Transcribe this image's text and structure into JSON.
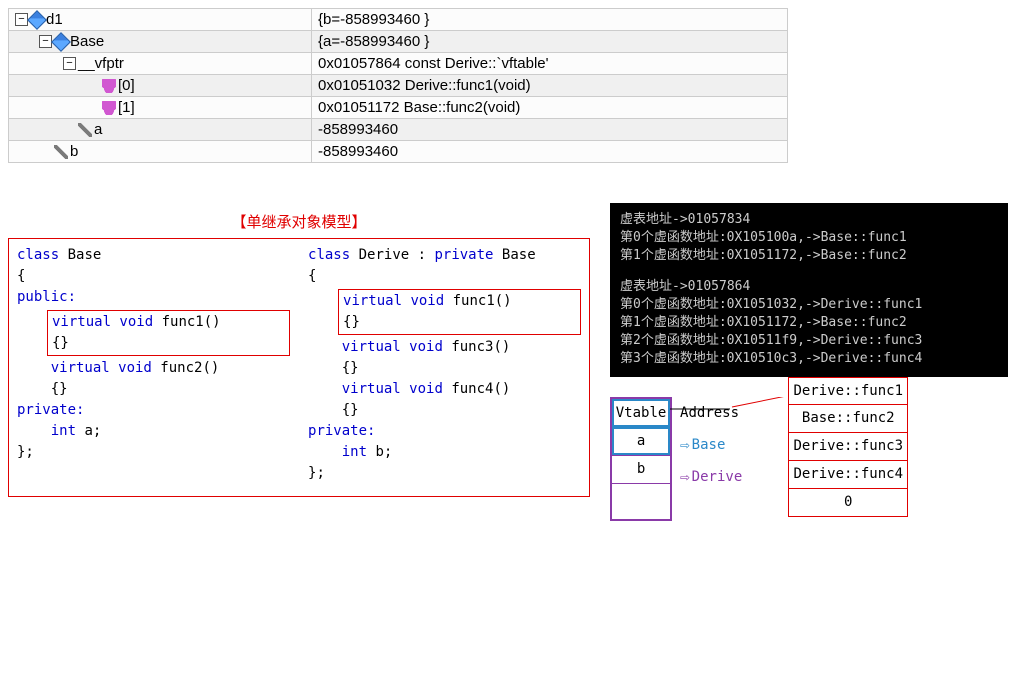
{
  "watch": {
    "rows": [
      {
        "indent": 0,
        "toggle": "−",
        "icon": "cube",
        "name": "d1",
        "value": "{b=-858993460 }"
      },
      {
        "indent": 1,
        "toggle": "−",
        "icon": "cube",
        "name": "Base",
        "value": "{a=-858993460 }"
      },
      {
        "indent": 2,
        "toggle": "−",
        "icon": "none",
        "name": "__vfptr",
        "value": "0x01057864 const Derive::`vftable'"
      },
      {
        "indent": 3,
        "toggle": "",
        "icon": "triples",
        "name": "[0]",
        "value": "0x01051032 Derive::func1(void)"
      },
      {
        "indent": 3,
        "toggle": "",
        "icon": "triples",
        "name": "[1]",
        "value": "0x01051172 Base::func2(void)"
      },
      {
        "indent": 2,
        "toggle": "",
        "icon": "wrench",
        "name": "a",
        "value": "-858993460"
      },
      {
        "indent": 1,
        "toggle": "",
        "icon": "wrench",
        "name": "b",
        "value": "-858993460"
      }
    ]
  },
  "diagram_title": "【单继承对象模型】",
  "code": {
    "base": {
      "decl": "class Base",
      "open": "{",
      "public": "public:",
      "func1": "virtual void func1()",
      "func1body": "{}",
      "func2": "virtual void func2()",
      "func2body": "{}",
      "private": "private:",
      "field": "int a;",
      "close": "};"
    },
    "derive": {
      "decl": "class Derive : private Base",
      "open": "{",
      "func1": "virtual void func1()",
      "func1body": "{}",
      "func3": "virtual void func3()",
      "func3body": "{}",
      "func4": "virtual void func4()",
      "func4body": "{}",
      "private": "private:",
      "field": "int b;",
      "close": "};"
    }
  },
  "console": {
    "lines1": [
      "虚表地址->01057834",
      "第0个虚函数地址:0X105100a,->Base::func1",
      "第1个虚函数地址:0X1051172,->Base::func2"
    ],
    "lines2": [
      "虚表地址->01057864",
      "第0个虚函数地址:0X1051032,->Derive::func1",
      "第1个虚函数地址:0X1051172,->Base::func2",
      "第2个虚函数地址:0X10511f9,->Derive::func3",
      "第3个虚函数地址:0X10510c3,->Derive::func4"
    ]
  },
  "mem": {
    "obj": {
      "vtable": "Vtable",
      "a": "a",
      "b": "b"
    },
    "address_label": "Address",
    "base_label": "Base",
    "derive_label": "Derive",
    "vtable_entries": [
      "Derive::func1",
      "Base::func2",
      "Derive::func3",
      "Derive::func4",
      "0"
    ]
  }
}
